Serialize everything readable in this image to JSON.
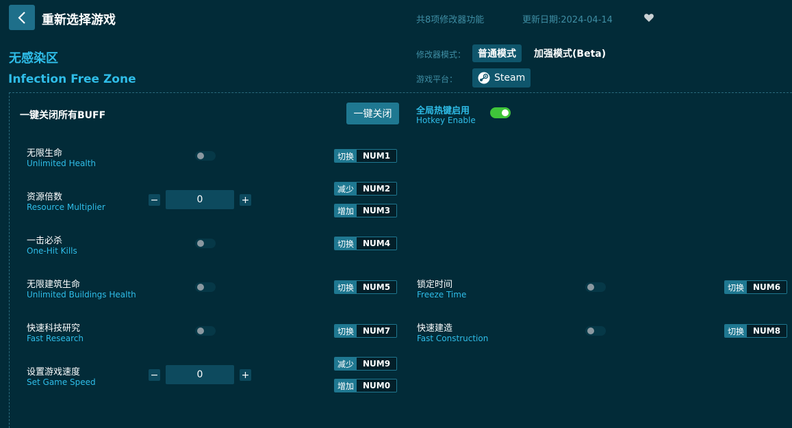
{
  "header": {
    "title": "重新选择游戏",
    "feature_count": "共8项修改器功能",
    "update_date": "更新日期:2024-04-14"
  },
  "game": {
    "name_cn": "无感染区",
    "name_en": "Infection Free Zone"
  },
  "mode": {
    "label": "修改器模式：",
    "normal": "普通模式",
    "enhanced": "加强模式(Beta)"
  },
  "platform": {
    "label": "游戏平台：",
    "name": "Steam"
  },
  "controls": {
    "disable_all_label": "一键关闭所有BUFF",
    "disable_all_button": "一键关闭",
    "hotkey_cn": "全局热键启用",
    "hotkey_en": "Hotkey Enable",
    "hotkey_enabled": true
  },
  "options": [
    {
      "cn": "无限生命",
      "en": "Unlimited Health",
      "type": "toggle",
      "on": false,
      "keys": [
        {
          "action": "切换",
          "key": "NUM1"
        }
      ]
    },
    {
      "cn": "资源倍数",
      "en": "Resource Multiplier",
      "type": "stepper",
      "value": "0",
      "keys": [
        {
          "action": "减少",
          "key": "NUM2"
        },
        {
          "action": "增加",
          "key": "NUM3"
        }
      ]
    },
    {
      "cn": "一击必杀",
      "en": "One-Hit Kills",
      "type": "toggle",
      "on": false,
      "keys": [
        {
          "action": "切换",
          "key": "NUM4"
        }
      ]
    },
    {
      "cn": "无限建筑生命",
      "en": "Unlimited Buildings Health",
      "type": "toggle",
      "on": false,
      "keys": [
        {
          "action": "切换",
          "key": "NUM5"
        }
      ]
    },
    {
      "cn": "快速科技研究",
      "en": "Fast Research",
      "type": "toggle",
      "on": false,
      "keys": [
        {
          "action": "切换",
          "key": "NUM7"
        }
      ]
    },
    {
      "cn": "设置游戏速度",
      "en": "Set Game Speed",
      "type": "stepper",
      "value": "0",
      "keys": [
        {
          "action": "减少",
          "key": "NUM9"
        },
        {
          "action": "增加",
          "key": "NUM0"
        }
      ]
    },
    {
      "cn": "锁定时间",
      "en": "Freeze Time",
      "type": "toggle",
      "on": false,
      "keys": [
        {
          "action": "切换",
          "key": "NUM6"
        }
      ]
    },
    {
      "cn": "快速建造",
      "en": "Fast Construction",
      "type": "toggle",
      "on": false,
      "keys": [
        {
          "action": "切换",
          "key": "NUM8"
        }
      ]
    }
  ],
  "stepper": {
    "minus": "−",
    "plus": "+"
  },
  "icons": {
    "back": "chevron-left-icon",
    "favorite": "heart-icon",
    "platform": "steam-icon"
  },
  "colors": {
    "background": "#022b38",
    "accent": "#2fbde8",
    "button": "#1f7891",
    "toggle_on": "#3fc43a"
  }
}
